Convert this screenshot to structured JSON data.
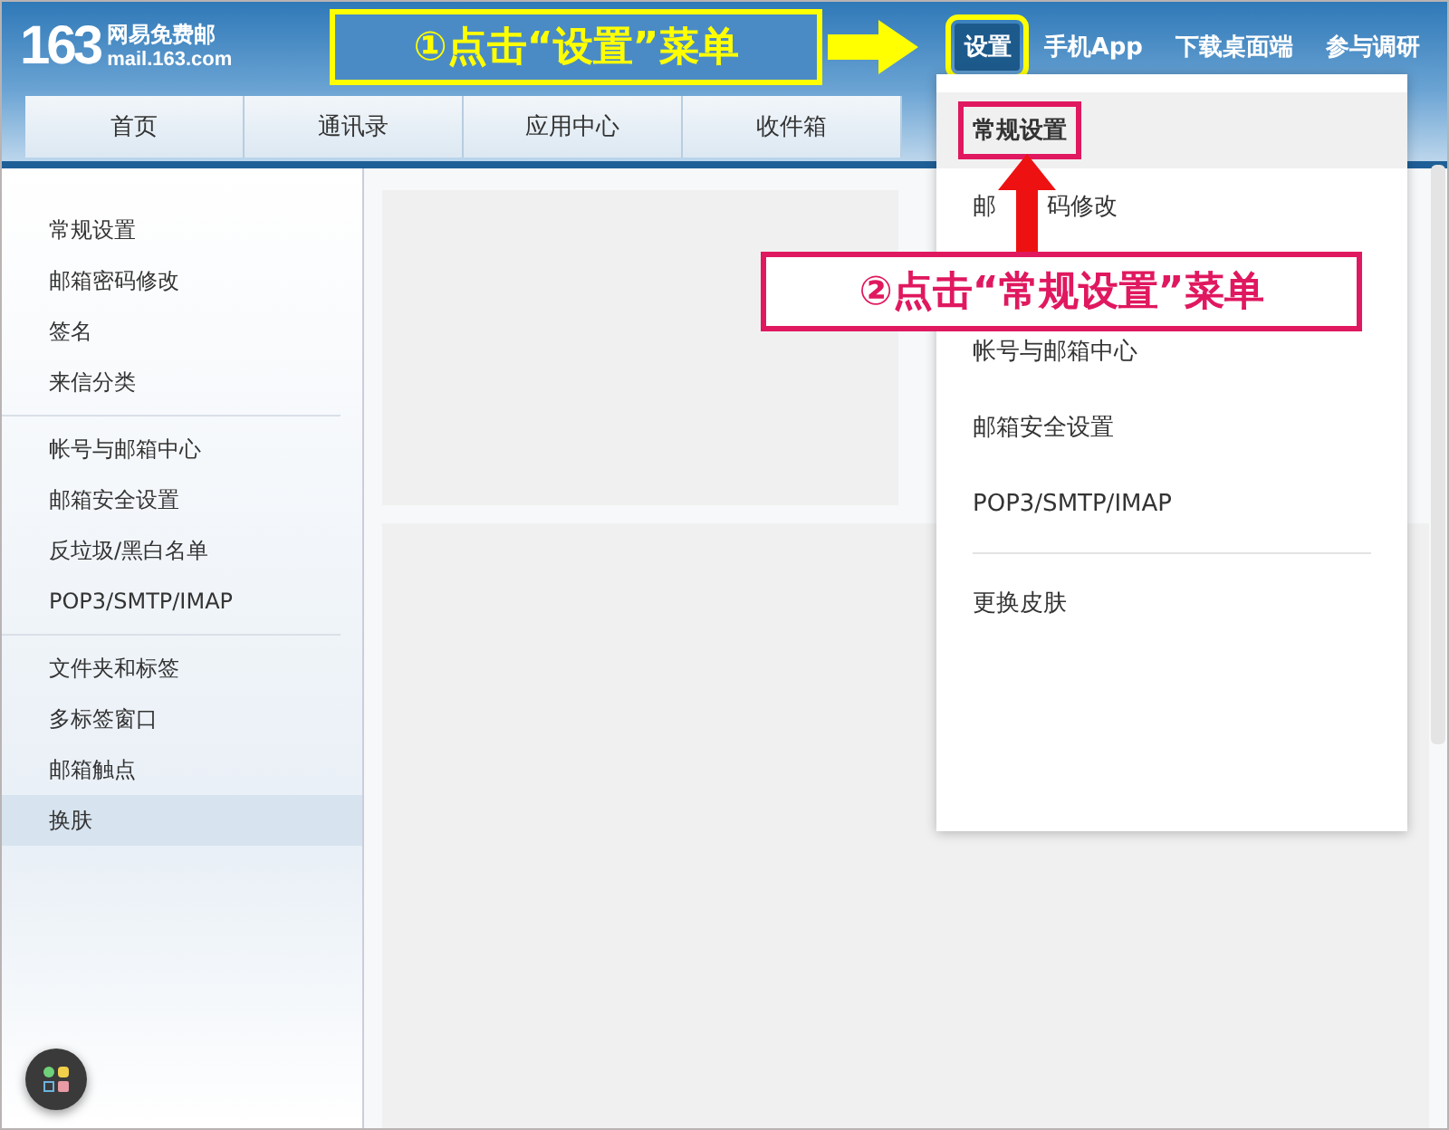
{
  "logo": {
    "number": "163",
    "name": "网易免费邮",
    "domain": "mail.163.com"
  },
  "top_links": [
    {
      "label": "设置",
      "selected": true
    },
    {
      "label": "手机App",
      "selected": false
    },
    {
      "label": "下载桌面端",
      "selected": false
    },
    {
      "label": "参与调研",
      "selected": false
    }
  ],
  "tabs": [
    {
      "label": "首页"
    },
    {
      "label": "通讯录"
    },
    {
      "label": "应用中心"
    },
    {
      "label": "收件箱"
    }
  ],
  "sidebar": {
    "groups": [
      {
        "items": [
          {
            "label": "常规设置",
            "selected": false
          },
          {
            "label": "邮箱密码修改",
            "selected": false
          },
          {
            "label": "签名",
            "selected": false
          },
          {
            "label": "来信分类",
            "selected": false
          }
        ]
      },
      {
        "items": [
          {
            "label": "帐号与邮箱中心",
            "selected": false
          },
          {
            "label": "邮箱安全设置",
            "selected": false
          },
          {
            "label": "反垃圾/黑白名单",
            "selected": false
          },
          {
            "label": "POP3/SMTP/IMAP",
            "selected": false
          }
        ]
      },
      {
        "items": [
          {
            "label": "文件夹和标签",
            "selected": false
          },
          {
            "label": "多标签窗口",
            "selected": false
          },
          {
            "label": "邮箱触点",
            "selected": false
          },
          {
            "label": "换肤",
            "selected": true
          }
        ]
      }
    ]
  },
  "dropdown": {
    "groups": [
      {
        "items": [
          {
            "label": "常规设置",
            "selected": true
          },
          {
            "label": "邮",
            "label_after_arrow": "码修改",
            "selected": false
          },
          {
            "label": "帐号与邮箱中心",
            "selected": false
          },
          {
            "label": "邮箱安全设置",
            "selected": false
          },
          {
            "label": "POP3/SMTP/IMAP",
            "selected": false
          }
        ]
      },
      {
        "items": [
          {
            "label": "更换皮肤",
            "selected": false
          }
        ]
      }
    ]
  },
  "annotations": [
    {
      "kind": "yellow",
      "text": "①点击“设置”菜单"
    },
    {
      "kind": "pink",
      "text": "②点击“常规设置”菜单"
    }
  ]
}
